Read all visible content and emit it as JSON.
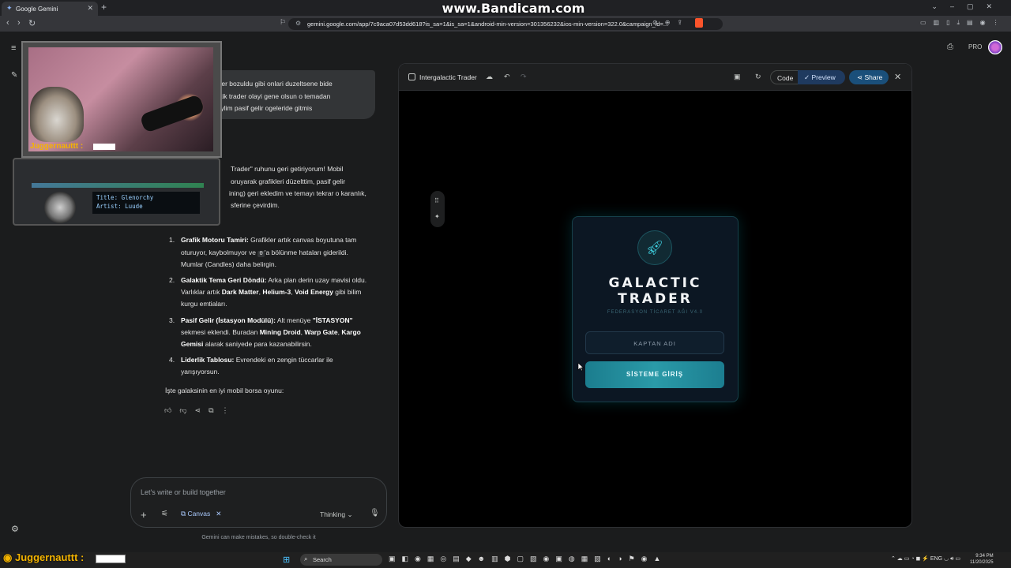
{
  "browser": {
    "tab_title": "Google Gemini",
    "url": "gemini.google.com/app/7c9aca07d53dd618?is_sa=1&is_sa=1&android-min-version=301356232&ios-min-version=322.0&campaign_id=...",
    "watermark": "www.Bandicam.com"
  },
  "gemini": {
    "plan_badge": "PRO",
    "user_message": [
      "fikler bozuldu gibi onlari duzeltsene bide",
      "aktik trader olayi gene olsun o temadan",
      "naylim pasif gelir ogeleride gitmis"
    ],
    "response_intro": [
      "Trader\" ruhunu geri getiriyorum! Mobil",
      "oruyarak grafikleri düzelttim, pasif gelir",
      "ining) geri ekledim ve temayı tekrar o karanlık,",
      "sferine çevirdim."
    ],
    "list": [
      {
        "num": "1.",
        "title": "Grafik Motoru Tamiri:",
        "l1": " Grafikler artık canvas boyutuna tam",
        "l2a": "oturuyor, kaybolmuyor ve ",
        "code": "0",
        "l2b": "'a bölünme hataları giderildi.",
        "l3": "Mumlar (Candles) daha belirgin."
      },
      {
        "num": "2.",
        "title": "Galaktik Tema Geri Döndü:",
        "l1": " Arka plan derin uzay mavisi oldu.",
        "l2a": "Varlıklar artık ",
        "b1": "Dark Matter",
        "sep1": ", ",
        "b2": "Helium-3",
        "sep2": ", ",
        "b3": "Void Energy",
        "l2b": " gibi bilim",
        "l3": "kurgu emtiaları."
      },
      {
        "num": "3.",
        "title": "Pasif Gelir (İstasyon Modülü):",
        "l1a": " Alt menüye ",
        "b1": "\"İSTASYON\"",
        "l2a": "sekmesi eklendi. Buradan ",
        "b2": "Mining Droid",
        "sep": ", ",
        "b3": "Warp Gate",
        "sep2": ", ",
        "b4": "Kargo",
        "b5": "Gemisi",
        "l3": " alarak saniyede para kazanabilirsin."
      },
      {
        "num": "4.",
        "title": "Liderlik Tablosu:",
        "l1": " Evrendeki en zengin tüccarlar ile",
        "l2": "yarışıyorsun."
      }
    ],
    "closing": "İşte galaksinin en iyi mobil borsa oyunu:",
    "prompt_placeholder": "Let's write or build together",
    "canvas_chip": "Canvas",
    "thinking_label": "Thinking",
    "disclaimer": "Gemini can make mistakes, so double-check it"
  },
  "overlay": {
    "streamer_tag": "Juggernauttt :",
    "music_title": "Title: Glenorchy",
    "music_artist": "Artist: Luude"
  },
  "canvas": {
    "title": "Intergalactic Trader",
    "code_label": "Code",
    "preview_label": "Preview",
    "share_label": "Share",
    "game": {
      "title_line1": "GALACTIC",
      "title_line2": "TRADER",
      "subtitle": "FEDERASYON TİCARET AĞI V4.0",
      "name_placeholder": "KAPTAN ADI",
      "login_button": "SİSTEME GİRİŞ",
      "accent": "#2a9aa8"
    }
  },
  "taskbar": {
    "streamer_tag": "Juggernauttt :",
    "search_label": "Search",
    "lang": "ENG",
    "time": "9:34 PM",
    "date": "11/20/2025"
  }
}
